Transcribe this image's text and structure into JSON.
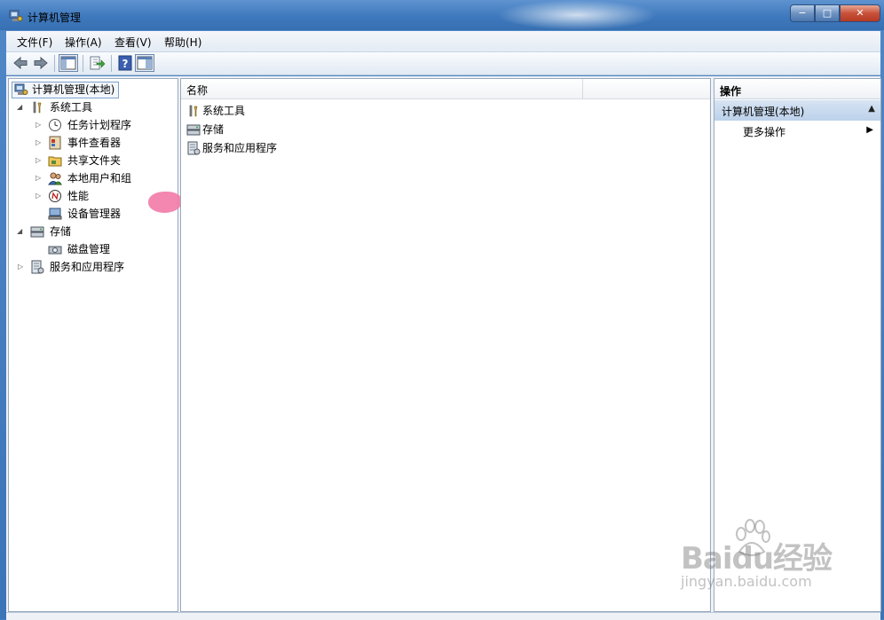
{
  "window": {
    "title": "计算机管理",
    "buttons": {
      "minimize": "−",
      "maximize": "□",
      "close": "✕"
    }
  },
  "menu": {
    "items": [
      "文件(F)",
      "操作(A)",
      "查看(V)",
      "帮助(H)"
    ]
  },
  "toolbar": {
    "icons": [
      "back-arrow-icon",
      "forward-arrow-icon",
      "show-hide-console-tree-icon",
      "export-list-icon",
      "help-icon",
      "show-hide-action-pane-icon"
    ]
  },
  "tree": {
    "root": "计算机管理(本地)",
    "nodes": [
      {
        "label": "系统工具",
        "icon": "tools-icon"
      },
      {
        "label": "任务计划程序",
        "icon": "clock-icon"
      },
      {
        "label": "事件查看器",
        "icon": "event-viewer-icon"
      },
      {
        "label": "共享文件夹",
        "icon": "shared-folder-icon"
      },
      {
        "label": "本地用户和组",
        "icon": "users-icon"
      },
      {
        "label": "性能",
        "icon": "performance-icon"
      },
      {
        "label": "设备管理器",
        "icon": "device-manager-icon"
      },
      {
        "label": "存储",
        "icon": "storage-icon"
      },
      {
        "label": "磁盘管理",
        "icon": "disk-icon"
      },
      {
        "label": "服务和应用程序",
        "icon": "services-icon"
      }
    ]
  },
  "list": {
    "column": "名称",
    "rows": [
      "系统工具",
      "存储",
      "服务和应用程序"
    ]
  },
  "actions": {
    "header": "操作",
    "section": "计算机管理(本地)",
    "more": "更多操作"
  },
  "watermark": {
    "brand": "Baidu经验",
    "url": "jingyan.baidu.com"
  },
  "colors": {
    "title_bar": "#3f79bd",
    "close_button": "#c8513a",
    "action_section": "#bcd1ea",
    "selection_border": "#7da2ce"
  }
}
